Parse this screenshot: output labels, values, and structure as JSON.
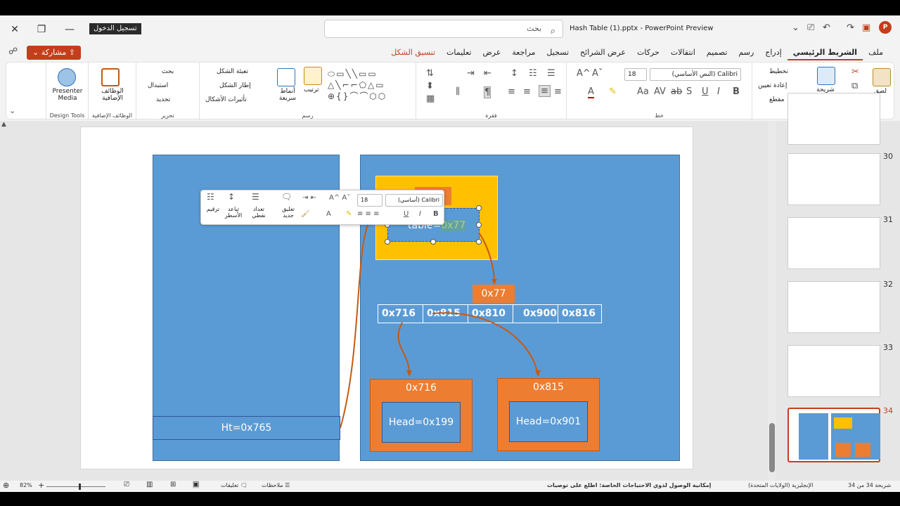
{
  "window": {
    "title": "Hash Table (1).pptx - PowerPoint Preview",
    "sign_in": "تسجيل الدخول",
    "search_placeholder": "بحث"
  },
  "menubar": {
    "share": "مشاركة",
    "tabs": [
      "ملف",
      "الشريط الرئيسي",
      "إدراج",
      "رسم",
      "تصميم",
      "انتقالات",
      "حركات",
      "عرض الشرائح",
      "تسجيل",
      "مراجعة",
      "عرض",
      "تعليمات",
      "تنسيق الشكل"
    ],
    "active": "الشريط الرئيسي",
    "context": "تنسيق الشكل"
  },
  "ribbon": {
    "clipboard": {
      "paste": "لصق",
      "group": "الحافظة"
    },
    "slides": {
      "new_slide": "شريحة جديدة",
      "layout": "تخطيط",
      "reset": "إعادة تعيين",
      "section": "مقطع",
      "group": "شرائح"
    },
    "font": {
      "name": "Calibri (النص الأساسي)",
      "size": "18",
      "group": "خط"
    },
    "paragraph": {
      "group": "فقرة"
    },
    "drawing": {
      "arrange": "ترتيب",
      "quick_styles": "أنماط سريعة",
      "fill": "تعبئة الشكل",
      "outline": "إطار الشكل",
      "effects": "تأثيرات الأشكال",
      "group": "رسم"
    },
    "editing": {
      "find": "بحث",
      "replace": "استبدال",
      "select": "تحديد",
      "group": "تحرير"
    },
    "addins": {
      "label": "الوظائف الإضافية",
      "group": "الوظائف الإضافية"
    },
    "design_tools": {
      "label": "Presenter Media",
      "group": "Design Tools"
    }
  },
  "slide": {
    "ht": "Ht=0x765",
    "table_prefix": "table=",
    "table_val": "0x77",
    "label_77": "0x77",
    "cells": [
      "0x716",
      "0x815",
      "0x810",
      "0x900",
      "0x816"
    ],
    "node1": {
      "addr": "0x716",
      "head": "Head=0x199"
    },
    "node2": {
      "addr": "0x815",
      "head": "Head=0x901"
    }
  },
  "minitoolbar": {
    "font": "Calibri (أساسي)",
    "size": "18",
    "numbering": "ترقيم",
    "spacing": "تباعد الأسطر",
    "bullets": "تعداد نقطي",
    "comment": "تعليق جديد"
  },
  "thumbnails": {
    "numbers": [
      "30",
      "31",
      "32",
      "33",
      "34"
    ],
    "current": "34"
  },
  "statusbar": {
    "slide": "شريحة 34 من 34",
    "lang": "الإنجليزية (الولايات المتحدة)",
    "access": "إمكانية الوصول لذوي الاحتياجات الخاصة: اطلع على توصيات",
    "notes": "ملاحظات",
    "comments": "تعليقات",
    "zoom": "82%"
  }
}
